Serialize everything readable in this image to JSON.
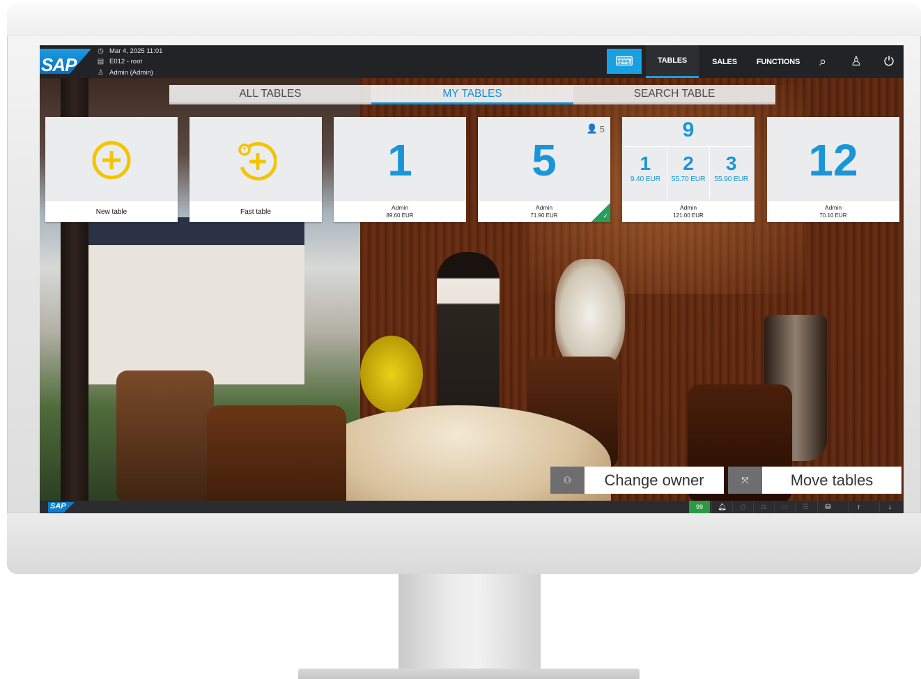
{
  "header": {
    "logo": "SAP",
    "datetime": "Mar 4, 2025 11:01",
    "store": "E012 - root",
    "user": "Admin (Admin)",
    "nav": [
      {
        "label": "TABLES",
        "active": true
      },
      {
        "label": "SALES",
        "active": false
      },
      {
        "label": "FUNCTIONS",
        "active": false
      }
    ]
  },
  "tabs": [
    {
      "label": "ALL TABLES",
      "active": false
    },
    {
      "label": "MY TABLES",
      "active": true
    },
    {
      "label": "SEARCH TABLE",
      "active": false
    }
  ],
  "tiles": {
    "new_table": {
      "label": "New table"
    },
    "fast_table": {
      "label": "Fast table"
    },
    "table_1": {
      "number": "1",
      "owner": "Admin",
      "amount": "89.60 EUR"
    },
    "table_5": {
      "number": "5",
      "guests": "5",
      "owner": "Admin",
      "amount": "71.90 EUR",
      "status_color": "#24a05a"
    },
    "table_9": {
      "number": "9",
      "owner": "Admin",
      "amount": "121.00 EUR",
      "subtables": [
        {
          "number": "1",
          "amount": "9.40 EUR"
        },
        {
          "number": "2",
          "amount": "55.70 EUR"
        },
        {
          "number": "3",
          "amount": "55.90 EUR"
        }
      ]
    },
    "table_12": {
      "number": "12",
      "owner": "Admin",
      "amount": "70.10 EUR"
    }
  },
  "actions": {
    "change_owner": "Change owner",
    "move_tables": "Move tables"
  },
  "statusbar": {
    "logo": "SAP",
    "count": "99"
  },
  "colors": {
    "accent": "#1a96d8",
    "plus_yellow": "#f5c400",
    "topbar": "#222326",
    "status_green": "#2a9a44"
  }
}
